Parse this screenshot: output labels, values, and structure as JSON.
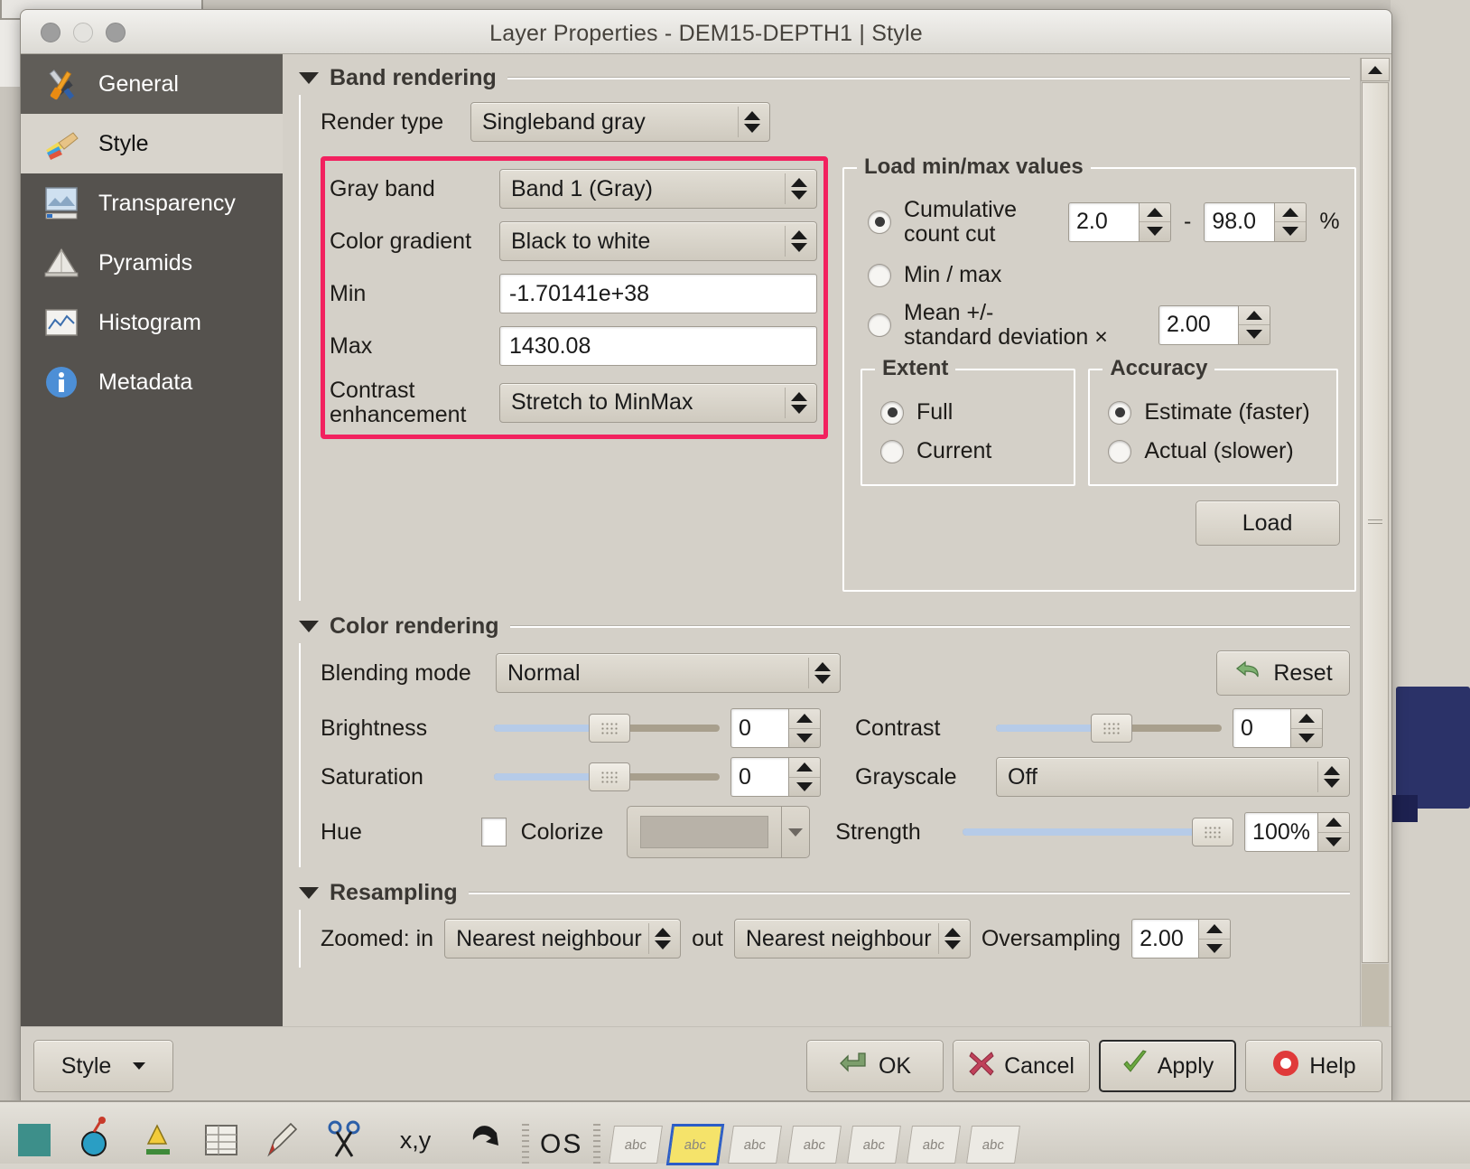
{
  "window": {
    "title": "Layer Properties - DEM15-DEPTH1 | Style",
    "traffic_lights": [
      "close",
      "minimize",
      "zoom"
    ]
  },
  "sidebar": {
    "items": [
      {
        "label": "General",
        "icon": "tools-icon",
        "state": "hover"
      },
      {
        "label": "Style",
        "icon": "paintbrush-icon",
        "state": "active"
      },
      {
        "label": "Transparency",
        "icon": "transparency-icon",
        "state": "normal"
      },
      {
        "label": "Pyramids",
        "icon": "pyramids-icon",
        "state": "normal"
      },
      {
        "label": "Histogram",
        "icon": "histogram-icon",
        "state": "normal"
      },
      {
        "label": "Metadata",
        "icon": "info-icon",
        "state": "normal"
      }
    ]
  },
  "band_rendering": {
    "group_label": "Band rendering",
    "render_type_label": "Render type",
    "render_type_value": "Singleband gray",
    "gray_band_label": "Gray band",
    "gray_band_value": "Band 1 (Gray)",
    "color_gradient_label": "Color gradient",
    "color_gradient_value": "Black to white",
    "min_label": "Min",
    "min_value": "-1.70141e+38",
    "max_label": "Max",
    "max_value": "1430.08",
    "contrast_label_line1": "Contrast",
    "contrast_label_line2": "enhancement",
    "contrast_value": "Stretch to MinMax",
    "highlight_color": "#f2215f"
  },
  "load_minmax": {
    "legend": "Load min/max values",
    "cumulative_label_line1": "Cumulative",
    "cumulative_label_line2": "count cut",
    "cumulative_selected": true,
    "cumulative_from": "2.0",
    "cumulative_dash": "-",
    "cumulative_to": "98.0",
    "percent_symbol": "%",
    "minmax_label": "Min / max",
    "minmax_selected": false,
    "mean_label_line1": "Mean +/-",
    "mean_label_line2": "standard deviation ×",
    "mean_selected": false,
    "mean_value": "2.00",
    "extent": {
      "legend": "Extent",
      "options": [
        {
          "label": "Full",
          "selected": true
        },
        {
          "label": "Current",
          "selected": false
        }
      ]
    },
    "accuracy": {
      "legend": "Accuracy",
      "options": [
        {
          "label": "Estimate (faster)",
          "selected": true
        },
        {
          "label": "Actual (slower)",
          "selected": false
        }
      ]
    },
    "load_button": "Load"
  },
  "color_rendering": {
    "group_label": "Color rendering",
    "blending_label": "Blending mode",
    "blending_value": "Normal",
    "reset_label": "Reset",
    "brightness_label": "Brightness",
    "brightness_value": "0",
    "contrast_label": "Contrast",
    "contrast_value": "0",
    "saturation_label": "Saturation",
    "saturation_value": "0",
    "grayscale_label": "Grayscale",
    "grayscale_value": "Off",
    "hue_label": "Hue",
    "colorize_label": "Colorize",
    "colorize_checked": false,
    "colorize_swatch": "#b8b2a8",
    "strength_label": "Strength",
    "strength_value": "100%"
  },
  "resampling": {
    "group_label": "Resampling",
    "zoomed_in_label": "Zoomed: in",
    "zoomed_in_value": "Nearest neighbour",
    "out_label": "out",
    "zoomed_out_value": "Nearest neighbour",
    "oversampling_label": "Oversampling",
    "oversampling_value": "2.00"
  },
  "buttons": {
    "style": "Style",
    "ok": "OK",
    "cancel": "Cancel",
    "apply": "Apply",
    "help": "Help"
  },
  "taskbar": {
    "labels": [
      "O",
      "S"
    ],
    "tags": [
      "abc",
      "abc",
      "abc",
      "abc",
      "abc",
      "abc",
      "abc"
    ]
  }
}
